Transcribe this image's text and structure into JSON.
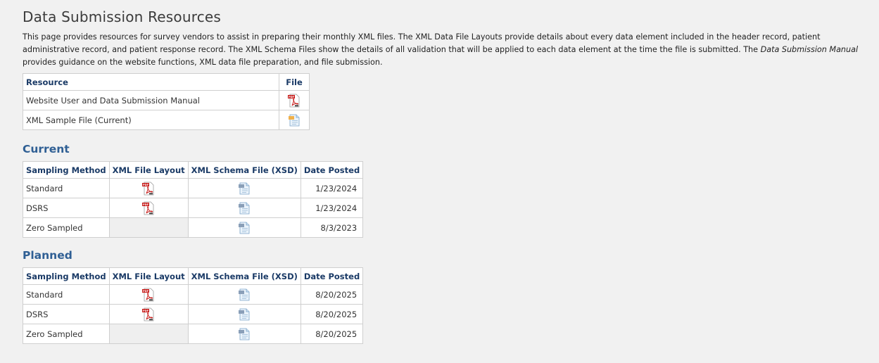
{
  "page": {
    "title": "Data Submission Resources",
    "intro_part1": "This page provides resources for survey vendors to assist in preparing their monthly XML files. The XML Data File Layouts provide details about every data element included in the header record, patient administrative record, and patient response record. The XML Schema Files show the details of all validation that will be applied to each data element at the time the file is submitted. The ",
    "intro_italic": "Data Submission Manual",
    "intro_part2": " provides guidance on the website functions, XML data file preparation, and file submission."
  },
  "resources": {
    "headers": {
      "resource": "Resource",
      "file": "File"
    },
    "rows": [
      {
        "resource": "Website User and Data Submission Manual",
        "icon": "pdf-icon"
      },
      {
        "resource": "XML Sample File (Current)",
        "icon": "xml-file-icon"
      }
    ]
  },
  "current": {
    "heading": "Current",
    "headers": {
      "method": "Sampling Method",
      "layout": "XML File Layout",
      "schema": "XML Schema File (XSD)",
      "date": "Date Posted"
    },
    "rows": [
      {
        "method": "Standard",
        "layout": "pdf-icon",
        "schema": "xsd-file-icon",
        "date": "1/23/2024"
      },
      {
        "method": "DSRS",
        "layout": "pdf-icon",
        "schema": "xsd-file-icon",
        "date": "1/23/2024"
      },
      {
        "method": "Zero Sampled",
        "layout": null,
        "schema": "xsd-file-icon",
        "date": "8/3/2023"
      }
    ]
  },
  "planned": {
    "heading": "Planned",
    "headers": {
      "method": "Sampling Method",
      "layout": "XML File Layout",
      "schema": "XML Schema File (XSD)",
      "date": "Date Posted"
    },
    "rows": [
      {
        "method": "Standard",
        "layout": "pdf-icon",
        "schema": "xsd-file-icon",
        "date": "8/20/2025"
      },
      {
        "method": "DSRS",
        "layout": "pdf-icon",
        "schema": "xsd-file-icon",
        "date": "8/20/2025"
      },
      {
        "method": "Zero Sampled",
        "layout": null,
        "schema": "xsd-file-icon",
        "date": "8/20/2025"
      }
    ]
  },
  "colors": {
    "heading_blue": "#2f5f94",
    "header_text": "#1a3a66",
    "pdf_red": "#c8201e"
  }
}
